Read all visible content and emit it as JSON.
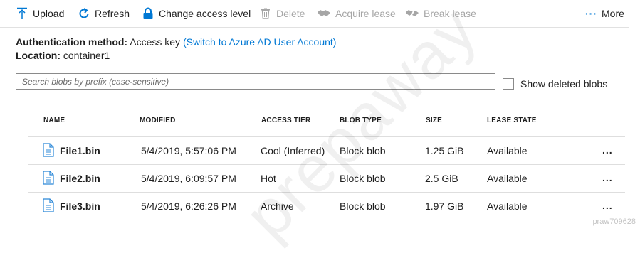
{
  "toolbar": {
    "upload": "Upload",
    "refresh": "Refresh",
    "change_access": "Change access level",
    "delete": "Delete",
    "acquire_lease": "Acquire lease",
    "break_lease": "Break lease",
    "more": "More",
    "icons": {
      "upload": "upload-icon",
      "refresh": "refresh-icon",
      "change_access": "lock-icon",
      "delete": "trash-icon",
      "acquire_lease": "lease-acquire-icon",
      "break_lease": "lease-break-icon",
      "more": "ellipsis-icon"
    },
    "accent": "#0078d4",
    "disabled_color": "#a6a6a6"
  },
  "info": {
    "auth_label": "Authentication method:",
    "auth_value": "Access key",
    "auth_link": "(Switch to Azure AD User Account)",
    "location_label": "Location:",
    "location_value": "container1"
  },
  "search": {
    "placeholder": "Search blobs by prefix (case-sensitive)",
    "value": ""
  },
  "show_deleted": {
    "label": "Show deleted blobs",
    "checked": false
  },
  "table": {
    "columns": [
      "NAME",
      "MODIFIED",
      "ACCESS TIER",
      "BLOB TYPE",
      "SIZE",
      "LEASE STATE"
    ],
    "rows": [
      {
        "name": "File1.bin",
        "modified": "5/4/2019, 5:57:06 PM",
        "tier": "Cool (Inferred)",
        "type": "Block blob",
        "size": "1.25 GiB",
        "lease": "Available",
        "more": "..."
      },
      {
        "name": "File2.bin",
        "modified": "5/4/2019, 6:09:57 PM",
        "tier": "Hot",
        "type": "Block blob",
        "size": "2.5 GiB",
        "lease": "Available",
        "more": "..."
      },
      {
        "name": "File3.bin",
        "modified": "5/4/2019, 6:26:26 PM",
        "tier": "Archive",
        "type": "Block blob",
        "size": "1.97 GiB",
        "lease": "Available",
        "more": "..."
      }
    ]
  },
  "watermark": {
    "text": "prepaway",
    "corner": "praw709628"
  }
}
